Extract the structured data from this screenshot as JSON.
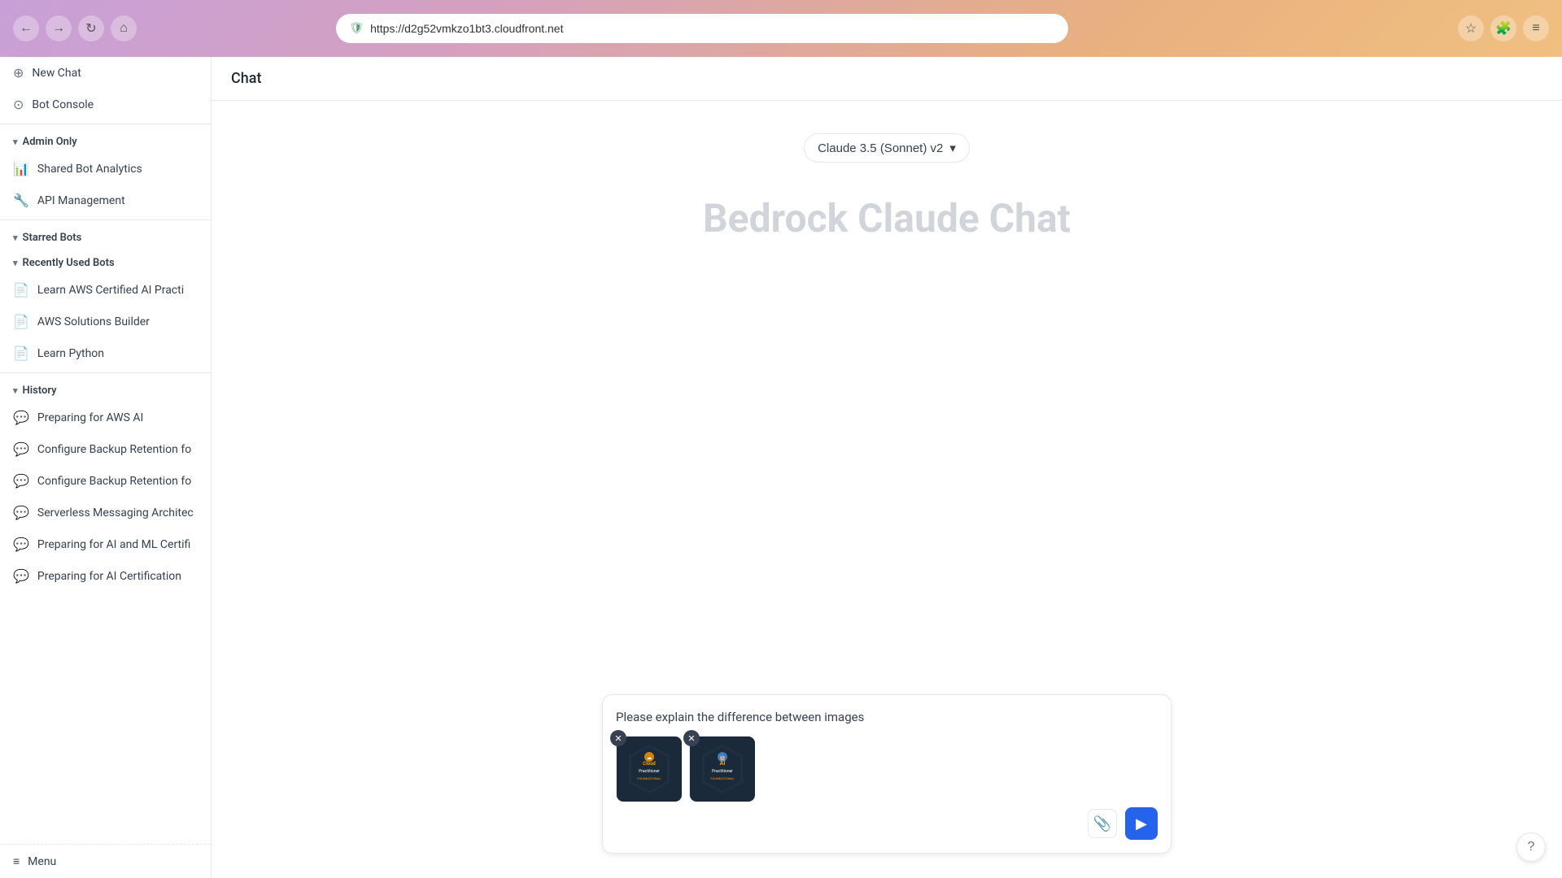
{
  "browser": {
    "url": "https://d2g52vmkzo1bt3.cloudfront.net",
    "back_icon": "←",
    "forward_icon": "→",
    "refresh_icon": "↻",
    "home_icon": "⌂",
    "star_icon": "☆",
    "extensions_icon": "🧩",
    "menu_icon": "≡"
  },
  "header": {
    "title": "Chat"
  },
  "sidebar": {
    "new_chat_label": "New Chat",
    "new_chat_icon": "⊕",
    "bot_console_label": "Bot Console",
    "bot_console_icon": "⊙",
    "admin_section_label": "Admin Only",
    "shared_bot_label": "Shared Bot Analytics",
    "shared_bot_icon": "📊",
    "api_management_label": "API Management",
    "api_management_icon": "🔧",
    "starred_section_label": "Starred Bots",
    "recently_section_label": "Recently Used Bots",
    "bots": [
      {
        "label": "Learn AWS Certified AI Practi",
        "icon": "📄"
      },
      {
        "label": "AWS Solutions Builder",
        "icon": "📄"
      },
      {
        "label": "Learn Python",
        "icon": "📄"
      }
    ],
    "history_section_label": "History",
    "history_items": [
      {
        "label": "Preparing for AWS AI",
        "icon": "💬"
      },
      {
        "label": "Configure Backup Retention fo",
        "icon": "💬"
      },
      {
        "label": "Configure Backup Retention fo",
        "icon": "💬"
      },
      {
        "label": "Serverless Messaging Architec",
        "icon": "💬"
      },
      {
        "label": "Preparing for AI and ML Certifi",
        "icon": "💬"
      },
      {
        "label": "Preparing for AI Certification",
        "icon": "💬"
      }
    ],
    "menu_label": "Menu",
    "menu_icon": "≡"
  },
  "chat": {
    "model_label": "Claude 3.5 (Sonnet) v2",
    "model_chevron": "▾",
    "title": "Bedrock Claude Chat",
    "input_text": "Please explain the difference between images",
    "attach_icon": "📎",
    "send_icon": "▶"
  },
  "images": [
    {
      "id": "img1",
      "alt": "AWS Cloud Practitioner Badge"
    },
    {
      "id": "img2",
      "alt": "AWS AI Practitioner Badge"
    }
  ],
  "help_icon": "?"
}
